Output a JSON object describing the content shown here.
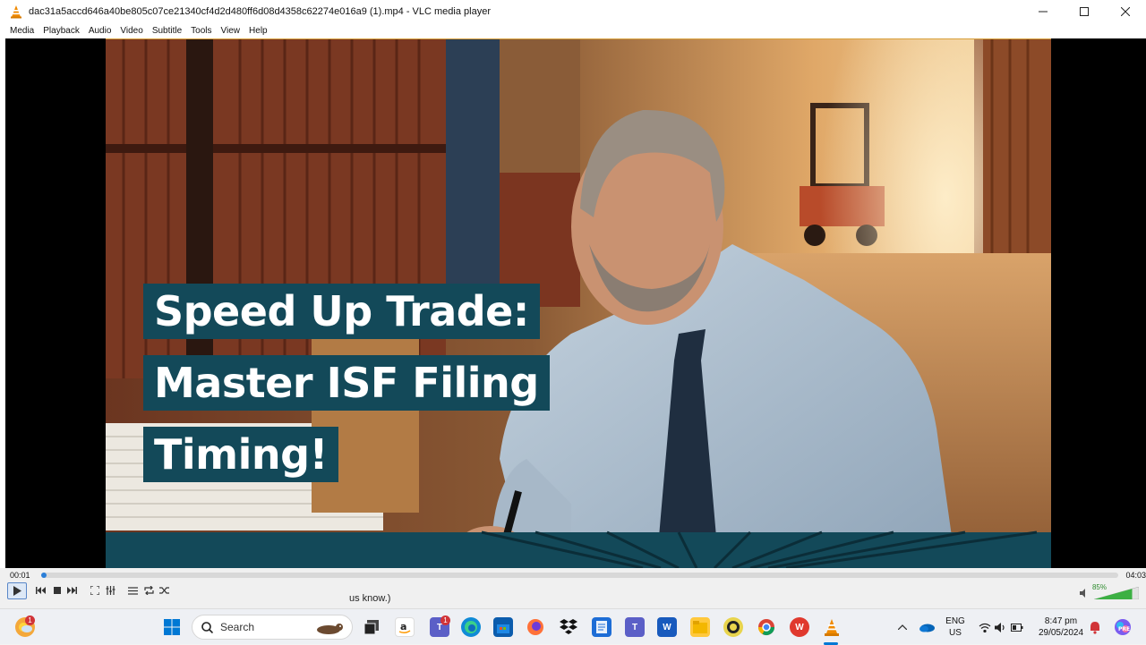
{
  "window": {
    "title": "dac31a5accd646a40be805c07ce21340cf4d2d480ff6d08d4358c62274e016a9 (1).mp4 - VLC media player",
    "controls": [
      "minimize",
      "maximize",
      "close"
    ]
  },
  "menu": {
    "items": [
      "Media",
      "Playback",
      "Audio",
      "Video",
      "Subtitle",
      "Tools",
      "View",
      "Help"
    ]
  },
  "video": {
    "headline_lines": [
      "Speed Up Trade:",
      "Master ISF Filing",
      "Timing!"
    ],
    "accent_color": "#134959"
  },
  "player": {
    "elapsed": "00:01",
    "duration": "04:03",
    "progress_fraction": 0.004,
    "volume_percent": "85%",
    "volume_fraction": 0.85,
    "buttons": [
      "play-icon",
      "previous-icon",
      "stop-icon",
      "next-icon",
      "fullscreen-icon",
      "extended-settings-icon",
      "playlist-icon",
      "loop-icon",
      "shuffle-icon"
    ]
  },
  "peek": {
    "text": "us know.)"
  },
  "taskbar": {
    "search_placeholder": "Search",
    "weather_badge": "1",
    "teams_badge": "1",
    "language": "ENG",
    "region": "US",
    "time": "8:47 pm",
    "date": "29/05/2024",
    "colors": {
      "windows": "#0078d4",
      "teams": "#5b5fc7",
      "word": "#185abd",
      "vlc": "#f08a00"
    }
  }
}
